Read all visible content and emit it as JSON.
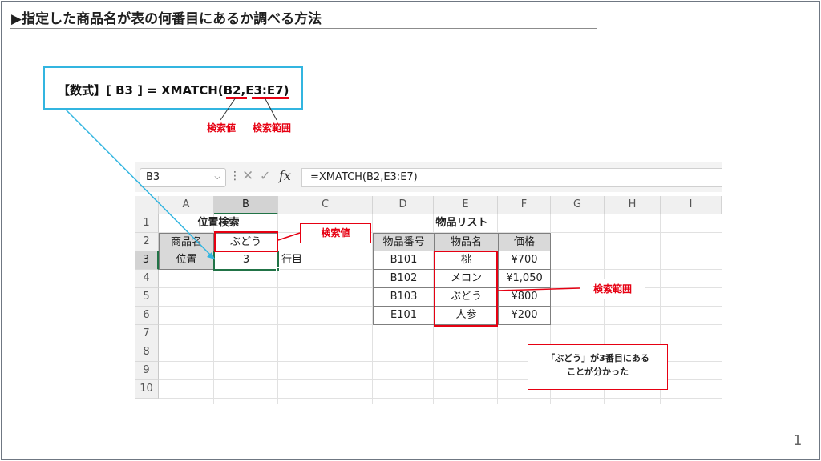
{
  "slide": {
    "title": "▶指定した商品名が表の何番目にあるか調べる方法",
    "page_number": "1",
    "formula": {
      "prefix": "【数式】[ B3 ] = XMATCH(",
      "arg1": "B2",
      "sep": ",",
      "arg2": "E3:E7",
      "suffix": ")",
      "label_arg1": "検索値",
      "label_arg2": "検索範囲"
    },
    "callouts": {
      "lookup_value": "検索値",
      "lookup_range": "検索範囲",
      "note_line1": "「ぶどう」が3番目にある",
      "note_line2": "ことが分かった"
    }
  },
  "excel": {
    "name_box": "B3",
    "formula_bar": "=XMATCH(B2,E3:E7)",
    "columns": [
      "A",
      "B",
      "C",
      "D",
      "E",
      "F",
      "G",
      "H",
      "I"
    ],
    "rows": [
      "1",
      "2",
      "3",
      "4",
      "5",
      "6",
      "7",
      "8",
      "9",
      "10"
    ],
    "position_table": {
      "title": "位置検索",
      "label_product": "商品名",
      "value_product": "ぶどう",
      "label_position": "位置",
      "value_position": "3",
      "suffix": "行目"
    },
    "product_list": {
      "title": "物品リスト",
      "headers": [
        "物品番号",
        "物品名",
        "価格"
      ],
      "rows": [
        [
          "B101",
          "桃",
          "¥700"
        ],
        [
          "B102",
          "メロン",
          "¥1,050"
        ],
        [
          "B103",
          "ぶどう",
          "¥800"
        ],
        [
          "E101",
          "人参",
          "¥200"
        ]
      ]
    }
  },
  "colors": {
    "red": "#e60012",
    "cyan": "#32b5e0",
    "excel_green": "#217346"
  }
}
